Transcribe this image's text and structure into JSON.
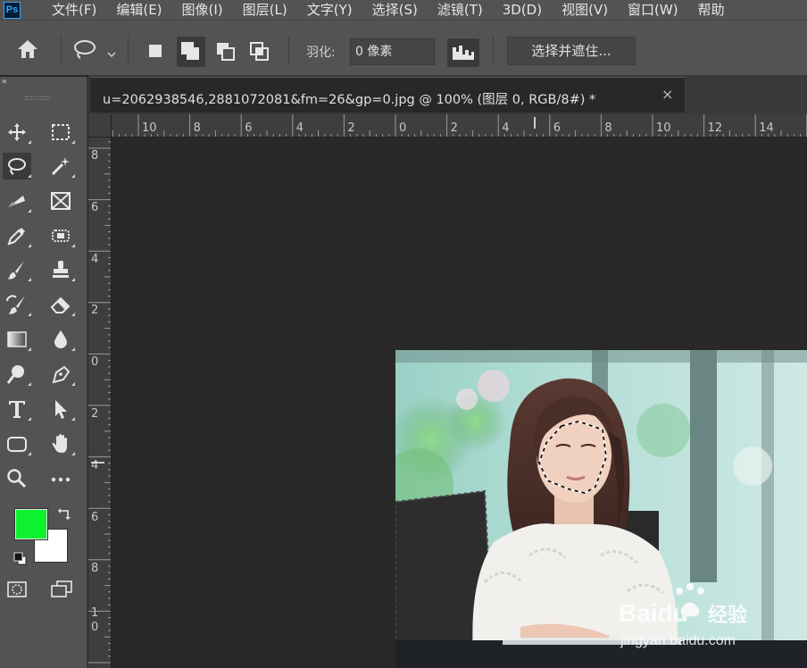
{
  "app": {
    "logo_text": "Ps"
  },
  "menubar": {
    "items": [
      "文件(F)",
      "编辑(E)",
      "图像(I)",
      "图层(L)",
      "文字(Y)",
      "选择(S)",
      "滤镜(T)",
      "3D(D)",
      "视图(V)",
      "窗口(W)",
      "帮助"
    ]
  },
  "options": {
    "feather_label": "羽化:",
    "feather_value": "0 像素",
    "refine_label": "选择并遮住..."
  },
  "tools_panel": {
    "collapse": "‹‹",
    "foreground_color": "#0df22e",
    "background_color": "#ffffff"
  },
  "document": {
    "tab_title": "u=2062938546,2881072081&fm=26&gp=0.jpg @ 100% (图层 0, RGB/8#) *",
    "close_glyph": "×"
  },
  "rulers": {
    "horizontal_labels": [
      "10",
      "8",
      "6",
      "4",
      "2",
      "0",
      "2",
      "4",
      "6",
      "8",
      "10",
      "12",
      "14"
    ],
    "vertical_labels": [
      "8",
      "6",
      "4",
      "2",
      "0",
      "2",
      "4",
      "6",
      "8",
      "1",
      "0"
    ]
  },
  "photo": {
    "watermark_brand": "Baidu",
    "watermark_cn": "经验",
    "watermark_url": "jingyan.baidu.com"
  }
}
